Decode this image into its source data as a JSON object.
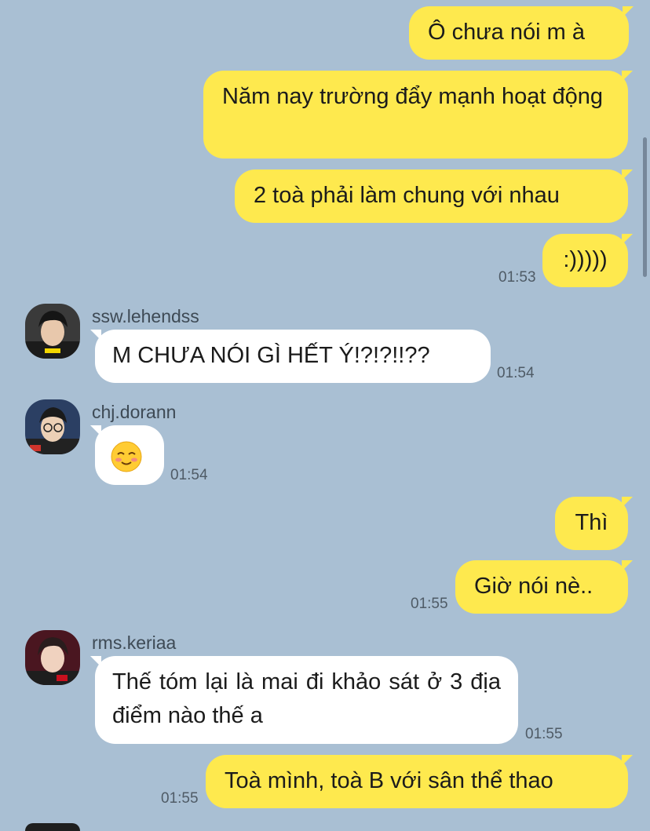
{
  "messages": [
    {
      "text": "Ô chưa nói m à"
    },
    {
      "text": "Năm nay trường đẩy mạnh hoạt động"
    },
    {
      "text": "2 toà phải làm chung với nhau"
    },
    {
      "text": ":)))))",
      "time": "01:53"
    },
    {
      "sender": "ssw.lehendss",
      "text": "M CHƯA NÓI GÌ HẾT Ý!?!?!!??",
      "time": "01:54"
    },
    {
      "sender": "chj.dorann",
      "emoji": "smiling-face-emoji",
      "time": "01:54"
    },
    {
      "text": "Thì"
    },
    {
      "text": "Giờ nói nè..",
      "time": "01:55"
    },
    {
      "sender": "rms.keriaa",
      "text": "Thế tóm lại là mai đi khảo sát ở 3 địa điểm nào thế a",
      "time": "01:55"
    },
    {
      "text": "Toà mình, toà B với sân thể thao",
      "time": "01:55"
    }
  ],
  "colors": {
    "background": "#a9bfd3",
    "outgoing_bubble": "#fee94e",
    "incoming_bubble": "#ffffff"
  }
}
